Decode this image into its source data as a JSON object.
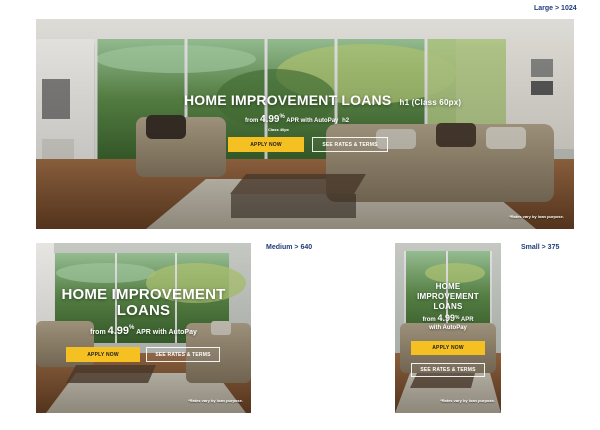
{
  "breakpoints": {
    "large": {
      "name": "Large",
      "rule": "> 1024"
    },
    "medium": {
      "name": "Medium",
      "rule": "> 640"
    },
    "small": {
      "name": "Small",
      "rule": "> 375"
    }
  },
  "hero": {
    "title": "HOME IMPROVEMENT LOANS",
    "title_line1": "HOME IMPROVEMENT",
    "title_line2": "LOANS",
    "small_title_line1": "HOME",
    "small_title_line2": "IMPROVEMENT",
    "small_title_line3": "LOANS",
    "h1_note": "h1 (Class 60px)",
    "h2_note": "h2",
    "class_note": "Class 40px",
    "rate_prefix": "from",
    "rate_value": "4.99",
    "rate_percent": "%",
    "rate_suffix": "APR with AutoPay",
    "apply_label": "APPLY NOW",
    "rates_label": "SEE RATES & TERMS",
    "footnote": "*Rates vary by loan purpose."
  },
  "colors": {
    "accent_yellow": "#f5c021",
    "label_blue": "#1f3d7a"
  }
}
